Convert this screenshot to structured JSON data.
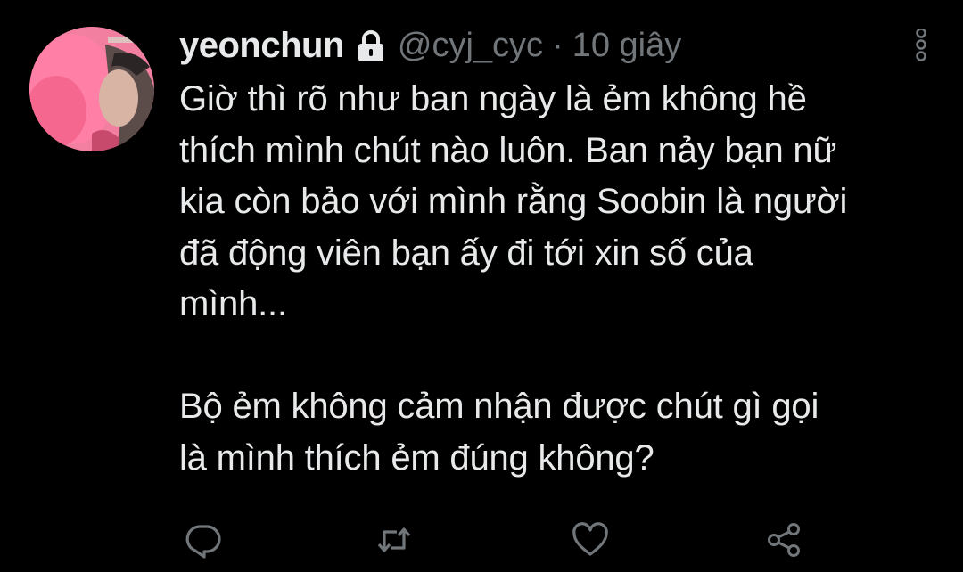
{
  "tweet": {
    "display_name": "yeonchun",
    "handle": "@cyj_cyc",
    "separator": "·",
    "time": "10 giây",
    "protected_icon": "lock-icon",
    "text": "Giờ thì rõ như ban ngày là ẻm không hề\nthích mình chút nào luôn. Ban nảy bạn nữ\nkia còn bảo với mình rằng Soobin là người\nđã động viên bạn ấy đi tới xin số của\nmình...\n\nBộ ẻm không cảm nhận được chút gì gọi\nlà mình thích ẻm đúng không?"
  },
  "actions": [
    {
      "name": "reply",
      "icon": "reply-icon"
    },
    {
      "name": "retweet",
      "icon": "retweet-icon"
    },
    {
      "name": "like",
      "icon": "heart-icon"
    },
    {
      "name": "share",
      "icon": "share-icon"
    }
  ],
  "colors": {
    "background": "#000000",
    "text_primary": "#e7e9ea",
    "text_secondary": "#71767b"
  }
}
